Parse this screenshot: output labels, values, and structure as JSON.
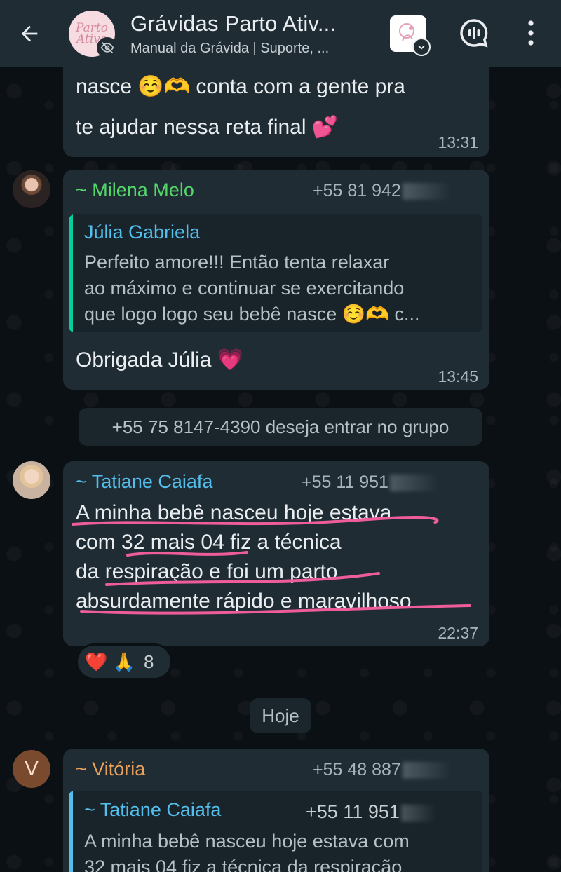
{
  "header": {
    "title": "Grávidas Parto Ativ...",
    "subtitle": "Manual da Grávida | Suporte, ...",
    "avatar_text": "Parto Ativo",
    "back_icon": "arrow-left-icon",
    "call_icon": "voice-call-icon",
    "menu_icon": "more-vertical-icon"
  },
  "messages": {
    "first": {
      "line1": "nasce ☺️🫶 conta com a gente pra",
      "line2": "te ajudar nessa reta final 💕",
      "time": "13:31"
    },
    "milena": {
      "sender": "~ Milena Melo",
      "phone": "+55 81 942",
      "quote_name": "Júlia Gabriela",
      "quote_line1": "Perfeito amore!!! Então tenta relaxar",
      "quote_line2": "ao máximo e continuar se exercitando",
      "quote_line3": "que logo logo seu bebê nasce ☺️🫶 c...",
      "text": "Obrigada Júlia 💗",
      "time": "13:45"
    },
    "system": {
      "text": "+55 75 8147-4390 deseja entrar no grupo"
    },
    "tatiane": {
      "sender": "~ Tatiane Caiafa",
      "phone": "+55 11 951",
      "line1": "A minha bebê nasceu hoje estava",
      "line2": "com 32 mais 04 fiz a técnica",
      "line3": "da respiração e foi um parto",
      "line4": "absurdamente rápido e maravilhoso",
      "time": "22:37",
      "reactions": "❤️ 🙏",
      "reaction_count": "8"
    },
    "date_divider": "Hoje",
    "vitoria": {
      "avatar_letter": "V",
      "sender": "~ Vitória",
      "phone": "+55 48 887",
      "quote_name": "~ Tatiane Caiafa",
      "quote_phone": "+55 11 951",
      "quote_line1": "A minha bebê nasceu hoje estava com",
      "quote_line2": "32 mais 04 fiz a técnica da respiração"
    }
  },
  "colors": {
    "header_bg": "#1f2c34",
    "bubble_bg": "#1f2c34",
    "milena_name": "#53d769",
    "tatiane_name": "#53bdeb",
    "vitoria_name": "#e9a15b",
    "quote_bar_teal": "#06cf9c",
    "quote_bar_blue": "#53bdeb",
    "underline_pink": "#ee5c9b"
  }
}
